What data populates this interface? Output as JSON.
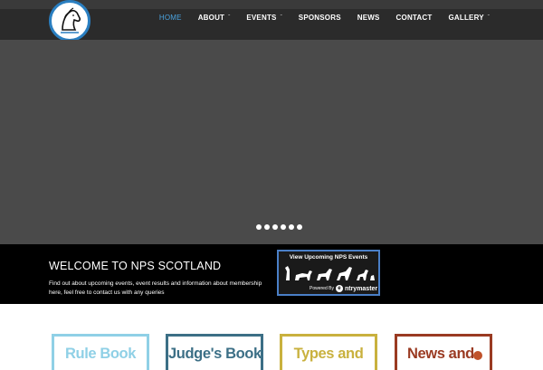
{
  "header": {
    "nav": [
      {
        "label": "HOME",
        "active": true,
        "has_dropdown": false
      },
      {
        "label": "ABOUT",
        "active": false,
        "has_dropdown": true
      },
      {
        "label": "EVENTS",
        "active": false,
        "has_dropdown": true
      },
      {
        "label": "SPONSORS",
        "active": false,
        "has_dropdown": false
      },
      {
        "label": "NEWS",
        "active": false,
        "has_dropdown": false
      },
      {
        "label": "CONTACT",
        "active": false,
        "has_dropdown": false
      },
      {
        "label": "GALLERY",
        "active": false,
        "has_dropdown": true
      }
    ],
    "dropdown_icon": "chevron-down-icon",
    "logo_icon": "horse-head-logo"
  },
  "hero": {
    "slide_count": 6,
    "active_slide": 1
  },
  "welcome": {
    "title": "WELCOME TO NPS SCOTLAND",
    "text": "Find out about upcoming events, event results and information about membership here, feel free to contact us with any queries"
  },
  "entrymaster": {
    "title": "View Upcoming NPS Events",
    "powered": "Powered By",
    "brand": "ntrymaster"
  },
  "cards": [
    {
      "label": "Rule Book",
      "color": "#8fd0e6"
    },
    {
      "label": "Judge's Book",
      "color": "#3c6f86"
    },
    {
      "label": "Types and",
      "color": "#c9b13e"
    },
    {
      "label": "News and",
      "color": "#9a3a22"
    }
  ],
  "colors": {
    "accent": "#4aa3df",
    "header_bg": "#2b2b2b",
    "hero_bg": "#4a4a4a",
    "band_bg": "#000000"
  }
}
